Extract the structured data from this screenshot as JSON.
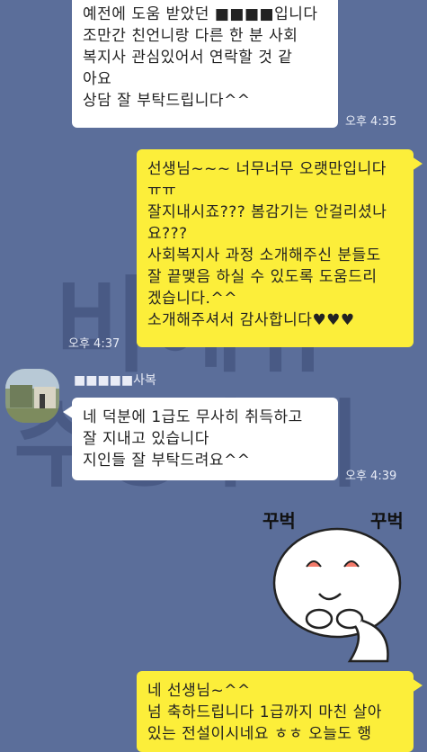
{
  "colors": {
    "background": "#5b6e9a",
    "my_bubble": "#fcee3a",
    "their_bubble": "#ffffff"
  },
  "watermark": {
    "line1": "비에듀",
    "line2": "수강후기"
  },
  "messages": [
    {
      "side": "left",
      "text": "예전에 도움 받았던 ■■■■입니다\n조만간 친언니랑 다른 한 분 사회\n복지사 관심있어서 연락할 것 같\n아요\n상담 잘 부탁드립니다^^",
      "time": "오후 4:35"
    },
    {
      "side": "right",
      "text": "선생님~~~ 너무너무 오랫만입니다\nㅠㅠ\n잘지내시죠??? 봄감기는 안걸리셨나\n요???\n사회복지사 과정 소개해주신 분들도\n 잘 끝맺음 하실 수 있도록 도움드리\n겠습니다.^^\n소개해주셔서 감사합니다♥♥♥",
      "time": "오후 4:37"
    },
    {
      "side": "left",
      "sender": "■■■■■사복",
      "text": "네 덕분에 1급도 무사히 취득하고\n잘 지내고 있습니다\n지인들 잘 부탁드려요^^",
      "time": "오후 4:39"
    },
    {
      "side": "right",
      "text": "네 선생님~^^\n넘 축하드립니다 1급까지 마친 살아\n있는 전설이시네요 ㅎㅎ 오늘도 행"
    }
  ],
  "sticker": {
    "label_left": "꾸벅",
    "label_right": "꾸벅",
    "icon": "bowing-character-sticker"
  }
}
